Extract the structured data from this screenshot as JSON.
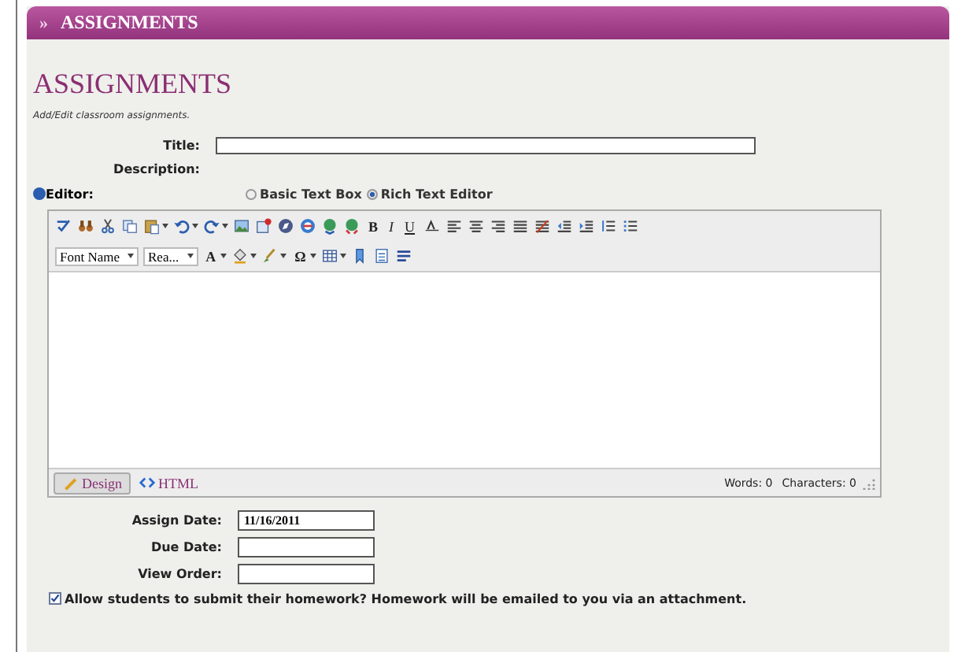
{
  "header": {
    "glyph": "»",
    "title": "ASSIGNMENTS"
  },
  "page": {
    "heading": "ASSIGNMENTS",
    "subtitle": "Add/Edit classroom assignments."
  },
  "title_field": {
    "label": "Title:"
  },
  "description": {
    "label": "Description:"
  },
  "editor_mode": {
    "label": "Editor:",
    "options": [
      {
        "label": "Basic Text Box",
        "selected": false
      },
      {
        "label": "Rich Text Editor",
        "selected": true
      }
    ]
  },
  "toolbar_rows": [
    [
      {
        "kind": "icon"
      },
      {
        "kind": "icon"
      },
      {
        "kind": "icon"
      },
      {
        "kind": "icon"
      },
      {
        "kind": "icon_dd"
      },
      {
        "kind": "icon_dd"
      },
      {
        "kind": "icon_dd"
      },
      {
        "kind": "icon"
      },
      {
        "kind": "icon"
      },
      {
        "kind": "icon"
      },
      {
        "kind": "icon"
      },
      {
        "kind": "icon"
      },
      {
        "kind": "icon"
      },
      {
        "kind": "bold",
        "text": "B"
      },
      {
        "kind": "italic",
        "text": "I"
      },
      {
        "kind": "underline",
        "text": "U"
      },
      {
        "kind": "icon"
      },
      {
        "kind": "icon"
      },
      {
        "kind": "icon"
      },
      {
        "kind": "icon"
      },
      {
        "kind": "icon"
      },
      {
        "kind": "icon"
      },
      {
        "kind": "icon"
      },
      {
        "kind": "icon"
      },
      {
        "kind": "icon"
      },
      {
        "kind": "icon"
      }
    ],
    [
      {
        "kind": "select",
        "text": "Font Name"
      },
      {
        "kind": "select",
        "text": "Rea..."
      },
      {
        "kind": "bold_dd",
        "text": "A"
      },
      {
        "kind": "icon_dd"
      },
      {
        "kind": "icon_dd"
      },
      {
        "kind": "bold_dd",
        "text": "Ω"
      },
      {
        "kind": "icon_dd"
      },
      {
        "kind": "icon"
      },
      {
        "kind": "icon"
      },
      {
        "kind": "icon"
      }
    ]
  ],
  "editor_tabs": [
    {
      "label": "Design",
      "selected": true
    },
    {
      "label": "HTML",
      "selected": false
    }
  ],
  "counts": [
    "Words: 0",
    "Characters: 0"
  ],
  "fields": [
    {
      "label": "Assign Date:",
      "value": "11/16/2011"
    },
    {
      "label": "Due Date:"
    },
    {
      "label": "View Order:"
    }
  ],
  "submit_option": {
    "label": "Allow students to submit their homework? Homework will be emailed to you via an attachment.",
    "checked": true
  }
}
